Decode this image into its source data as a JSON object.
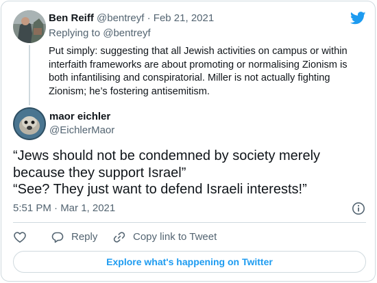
{
  "colors": {
    "accent": "#1d9bf0",
    "text": "#0f1419",
    "muted": "#536471",
    "border": "#cfd9de"
  },
  "parent_tweet": {
    "name": "Ben Reiff",
    "handle": "@bentreyf",
    "separator": "·",
    "date": "Feb 21, 2021",
    "replying_label": "Replying to",
    "replying_handle": "@bentreyf",
    "text": "Put simply: suggesting that all Jewish activities on campus or within interfaith frameworks are about promoting or normalising Zionism is both infantilising and conspiratorial. Miller is not actually fighting Zionism; he’s fostering antisemitism."
  },
  "tweet": {
    "name": "maor eichler",
    "handle": "@EichlerMaor",
    "lines": [
      "“Jews should not be condemned by society merely because they support Israel”",
      "“See? They just want to defend Israeli interests!”"
    ],
    "timestamp": "5:51 PM · Mar 1, 2021"
  },
  "actions": {
    "like_icon": "heart-icon",
    "reply_label": "Reply",
    "copy_label": "Copy link to Tweet"
  },
  "explore_label": "Explore what's happening on Twitter"
}
